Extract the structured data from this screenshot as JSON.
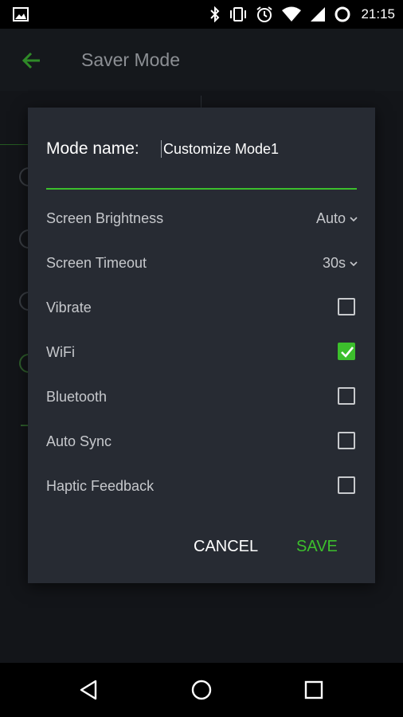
{
  "status_bar": {
    "time": "21:15",
    "icons": [
      "image-icon",
      "bluetooth-icon",
      "vibrate-icon",
      "alarm-icon",
      "wifi-icon",
      "signal-icon",
      "battery-icon"
    ]
  },
  "app_bar": {
    "title": "Saver Mode"
  },
  "dialog": {
    "mode_label": "Mode name:",
    "mode_value": "Customize Mode1",
    "settings": [
      {
        "label": "Screen Brightness",
        "type": "dropdown",
        "value": "Auto"
      },
      {
        "label": "Screen Timeout",
        "type": "dropdown",
        "value": "30s"
      },
      {
        "label": "Vibrate",
        "type": "checkbox",
        "checked": false
      },
      {
        "label": "WiFi",
        "type": "checkbox",
        "checked": true
      },
      {
        "label": "Bluetooth",
        "type": "checkbox",
        "checked": false
      },
      {
        "label": "Auto Sync",
        "type": "checkbox",
        "checked": false
      },
      {
        "label": "Haptic Feedback",
        "type": "checkbox",
        "checked": false
      }
    ],
    "cancel_label": "CANCEL",
    "save_label": "SAVE"
  },
  "colors": {
    "accent": "#3cbf2c",
    "dialog_bg": "#272b33"
  }
}
